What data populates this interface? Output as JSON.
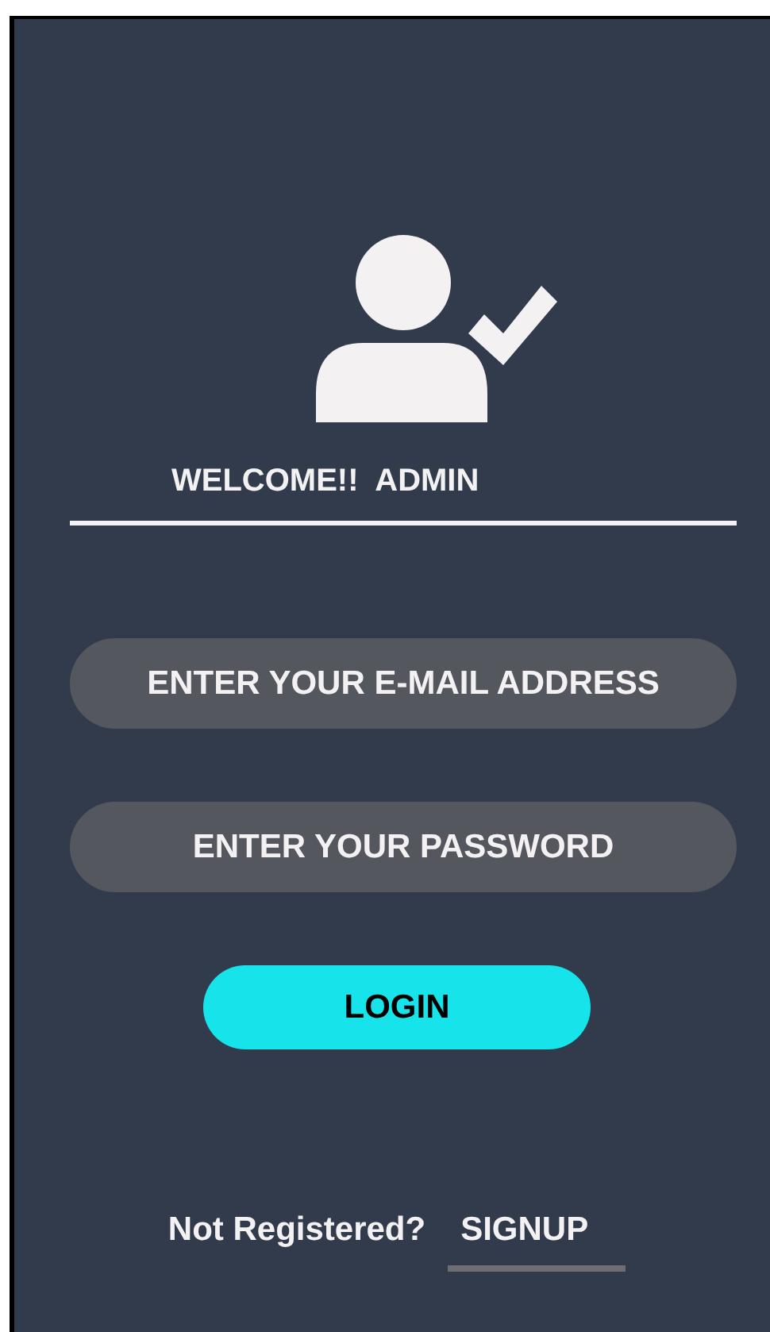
{
  "header": {
    "greeting": "WELCOME!!  ADMIN"
  },
  "fields": [
    {
      "placeholder": "ENTER YOUR E-MAIL ADDRESS"
    },
    {
      "placeholder": "ENTER YOUR PASSWORD"
    }
  ],
  "login_button": "LOGIN",
  "footer": {
    "prompt": "Not Registered?",
    "signup_link": "SIGNUP"
  }
}
